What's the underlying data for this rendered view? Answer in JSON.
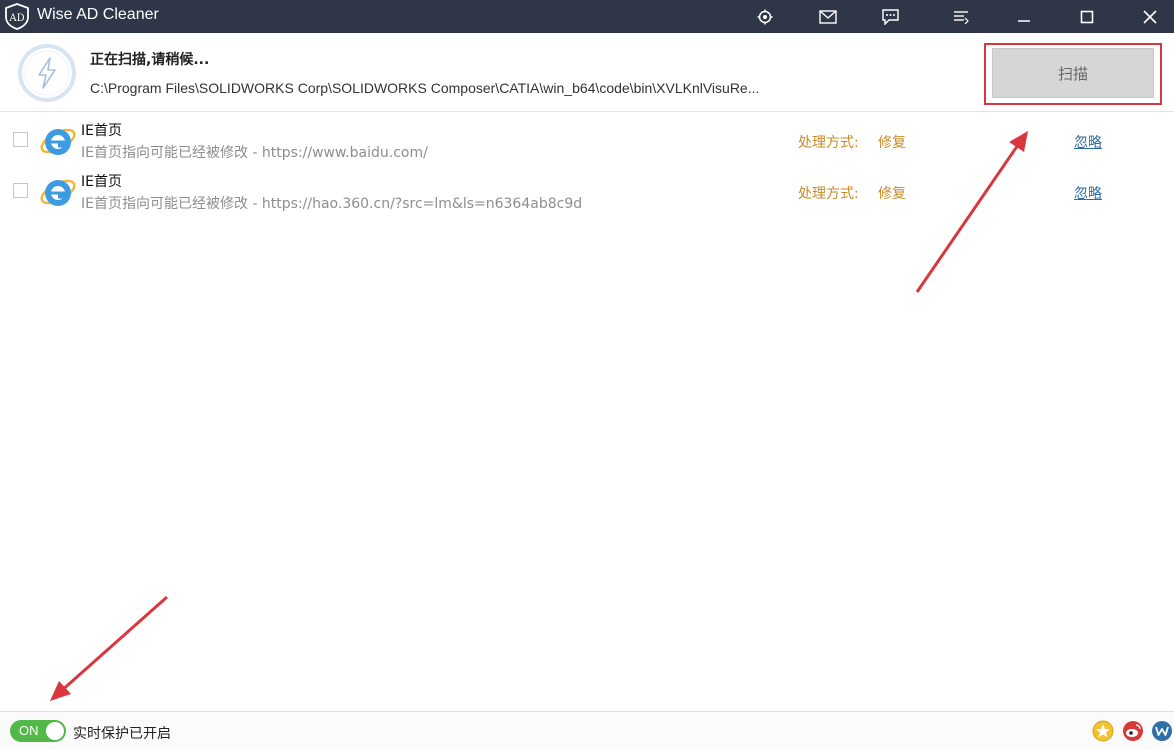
{
  "window": {
    "title": "Wise AD Cleaner",
    "logo_text": "AD",
    "controls": [
      "target-icon",
      "mail-icon",
      "feedback-icon",
      "menu-icon",
      "minimize-icon",
      "maximize-icon",
      "close-icon"
    ]
  },
  "scan": {
    "status": "正在扫描,请稍候...",
    "current_path": "C:\\Program Files\\SOLIDWORKS Corp\\SOLIDWORKS Composer\\CATIA\\win_b64\\code\\bin\\XVLKnlVisuRe...",
    "button_label": "扫描",
    "icon": "lightning-icon"
  },
  "results": [
    {
      "name": "IE首页",
      "description": "IE首页指向可能已经被修改 - https://www.baidu.com/",
      "handle_label": "处理方式:",
      "handle_value": "修复",
      "ignore_label": "忽略",
      "checked": false
    },
    {
      "name": "IE首页",
      "description": "IE首页指向可能已经被修改 - https://hao.360.cn/?src=lm&ls=n6364ab8c9d",
      "handle_label": "处理方式:",
      "handle_value": "修复",
      "ignore_label": "忽略",
      "checked": false
    }
  ],
  "status_bar": {
    "toggle_label": "ON",
    "protection_text": "实时保护已开启",
    "icons": [
      "star-badge-icon",
      "weibo-icon",
      "wise-icon"
    ]
  },
  "colors": {
    "titlebar": "#2e3648",
    "accent_orange": "#c98b25",
    "link_blue": "#2e6da4",
    "toggle_green": "#52b848",
    "annotation_red": "#d9363e"
  }
}
